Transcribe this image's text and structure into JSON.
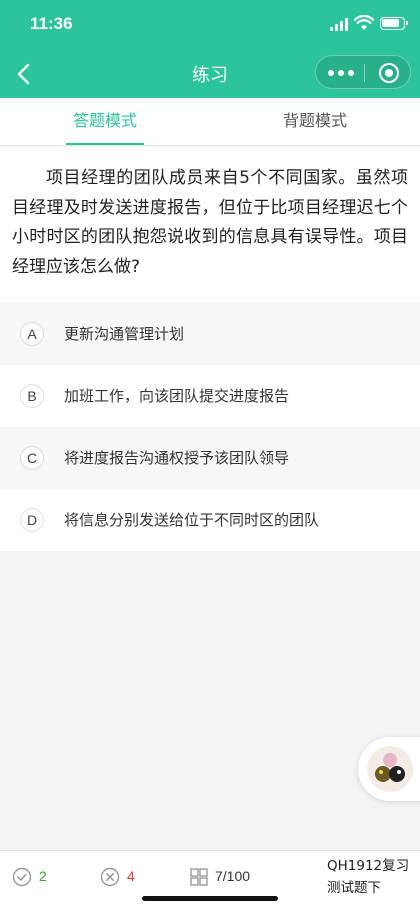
{
  "status": {
    "time": "11:36"
  },
  "nav": {
    "title": "练习"
  },
  "tabs": [
    {
      "label": "答题模式",
      "active": true
    },
    {
      "label": "背题模式",
      "active": false
    }
  ],
  "question": {
    "text": "项目经理的团队成员来自5个不同国家。虽然项目经理及时发送进度报告，但位于比项目经理迟七个小时时区的团队抱怨说收到的信息具有误导性。项目经理应该怎么做?"
  },
  "options": [
    {
      "letter": "A",
      "text": "更新沟通管理计划"
    },
    {
      "letter": "B",
      "text": "加班工作，向该团队提交进度报告"
    },
    {
      "letter": "C",
      "text": "将进度报告沟通权授予该团队领导"
    },
    {
      "letter": "D",
      "text": "将信息分别发送给位于不同时区的团队"
    }
  ],
  "bottom": {
    "correct_count": "2",
    "wrong_count": "4",
    "progress": "7/100",
    "exam_title_line1": "QH1912复习",
    "exam_title_line2": "测试题下"
  },
  "colors": {
    "accent": "#2cc49a",
    "correct": "#3aa83a",
    "wrong": "#e03a3a"
  }
}
